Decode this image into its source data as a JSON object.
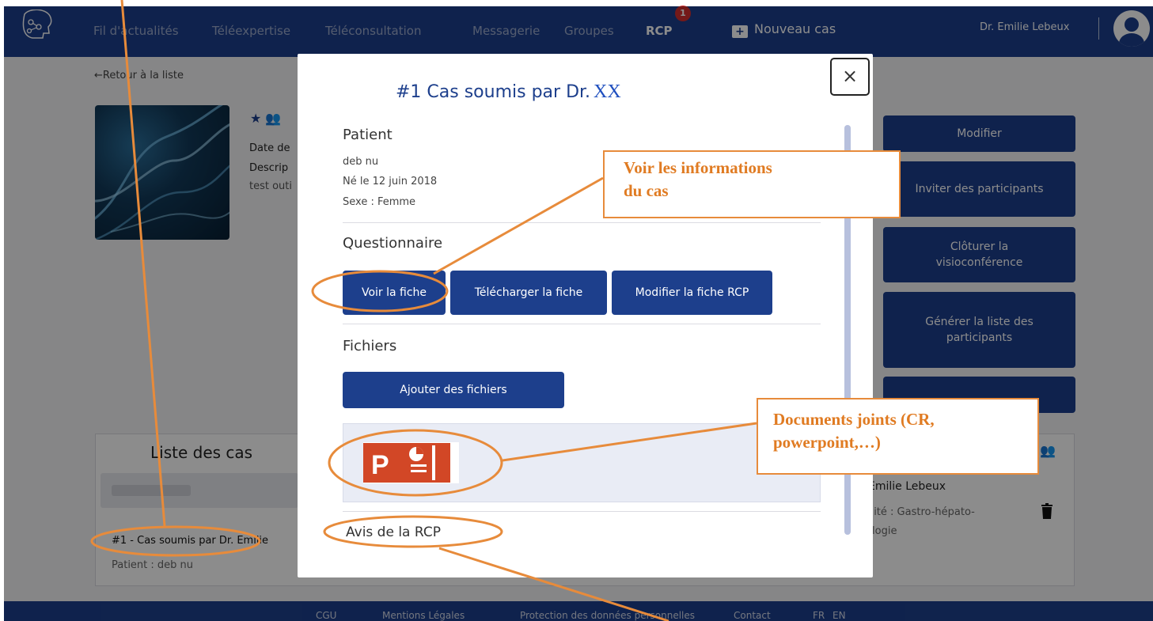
{
  "nav": {
    "items": [
      "Fil d'actualités",
      "Téléexpertise",
      "Téléconsultation",
      "Messagerie",
      "Groupes",
      "RCP"
    ],
    "rcp_badge": "1",
    "new_case_icon": "+",
    "new_case": "Nouveau cas",
    "user_name": "Dr. Emilie Lebeux"
  },
  "page": {
    "back_link": "←Retour à la liste",
    "meta_date_label": "Date de",
    "meta_desc_label": "Descrip",
    "meta_desc_value": "test outi"
  },
  "side_buttons": [
    "Modifier",
    "Inviter des participants",
    "Clôturer la visioconférence",
    "Générer la liste des participants"
  ],
  "cases": {
    "title": "Liste des cas",
    "item_title": "#1 - Cas soumis par Dr. Emilie",
    "item_patient": "Patient : deb nu",
    "participant_name": "Emilie Lebeux",
    "participant_spec_1": "ialité : Gastro-hépato-",
    "participant_spec_2": "rologie"
  },
  "modal": {
    "title": "#1 Cas soumis par Dr.",
    "title_redacted": "XX",
    "close": "×",
    "patient_heading": "Patient",
    "patient_name": "deb nu",
    "patient_dob": "Né le 12 juin 2018",
    "patient_sex": "Sexe : Femme",
    "questionnaire_heading": "Questionnaire",
    "btn_view": "Voir la fiche",
    "btn_download": "Télécharger la fiche",
    "btn_edit": "Modifier la fiche RCP",
    "files_heading": "Fichiers",
    "btn_add_files": "Ajouter des fichiers",
    "file_icon": "powerpoint-icon",
    "avis_heading": "Avis de la RCP"
  },
  "annotations": {
    "info_line1": "Voir les informations",
    "info_line2": "du cas",
    "docs_line1": "Documents joints (CR,",
    "docs_line2": "powerpoint,…)"
  },
  "footer": [
    "CGU",
    "Mentions Légales",
    "Protection des données personnelles",
    "Contact",
    "FR",
    "EN"
  ],
  "colors": {
    "brand": "#1d3f8c",
    "annotation": "#e78b3b",
    "badge": "#d32f2f",
    "powerpoint": "#d24726"
  }
}
